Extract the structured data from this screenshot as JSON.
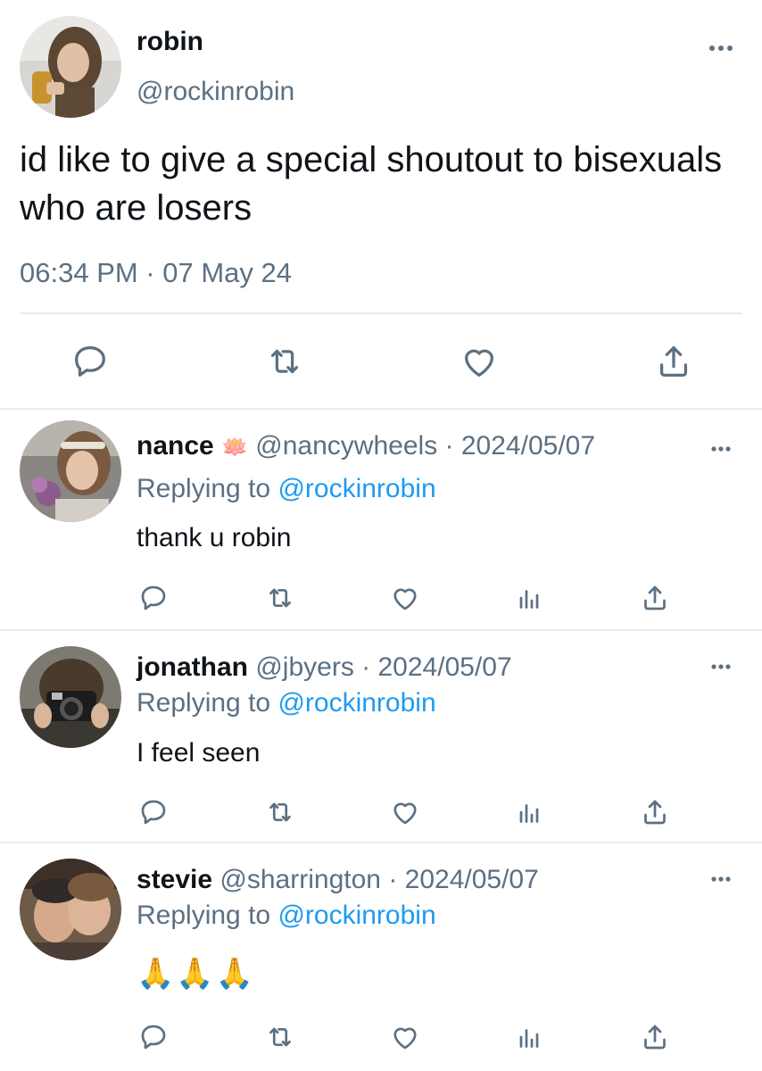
{
  "main_tweet": {
    "name": "robin",
    "handle": "@rockinrobin",
    "text": "id like to give a special shoutout to bisexuals who are losers",
    "timestamp": "06:34 PM · 07 May 24",
    "actions": [
      "reply-icon",
      "retweet-icon",
      "like-icon",
      "share-icon"
    ]
  },
  "replies": [
    {
      "name": "nance",
      "emoji": "🪷",
      "handle": "@nancywheels",
      "date": "· 2024/05/07",
      "replying_label": "Replying to",
      "replying_to": "@rockinrobin",
      "text": "thank u robin"
    },
    {
      "name": "jonathan",
      "emoji": "",
      "handle": "@jbyers",
      "date": "· 2024/05/07",
      "replying_label": "Replying to",
      "replying_to": "@rockinrobin",
      "text": "I feel seen"
    },
    {
      "name": "stevie",
      "emoji": "",
      "handle": "@sharrington",
      "date": "· 2024/05/07",
      "replying_label": "Replying to",
      "replying_to": "@rockinrobin",
      "text": "🙏🙏🙏"
    }
  ],
  "reply_actions": [
    "reply-icon",
    "retweet-icon",
    "like-icon",
    "analytics-icon",
    "share-icon"
  ],
  "colors": {
    "text": "#0f1419",
    "secondary": "#5b7083",
    "link": "#1d9bf0",
    "divider": "#e6ecf0"
  }
}
